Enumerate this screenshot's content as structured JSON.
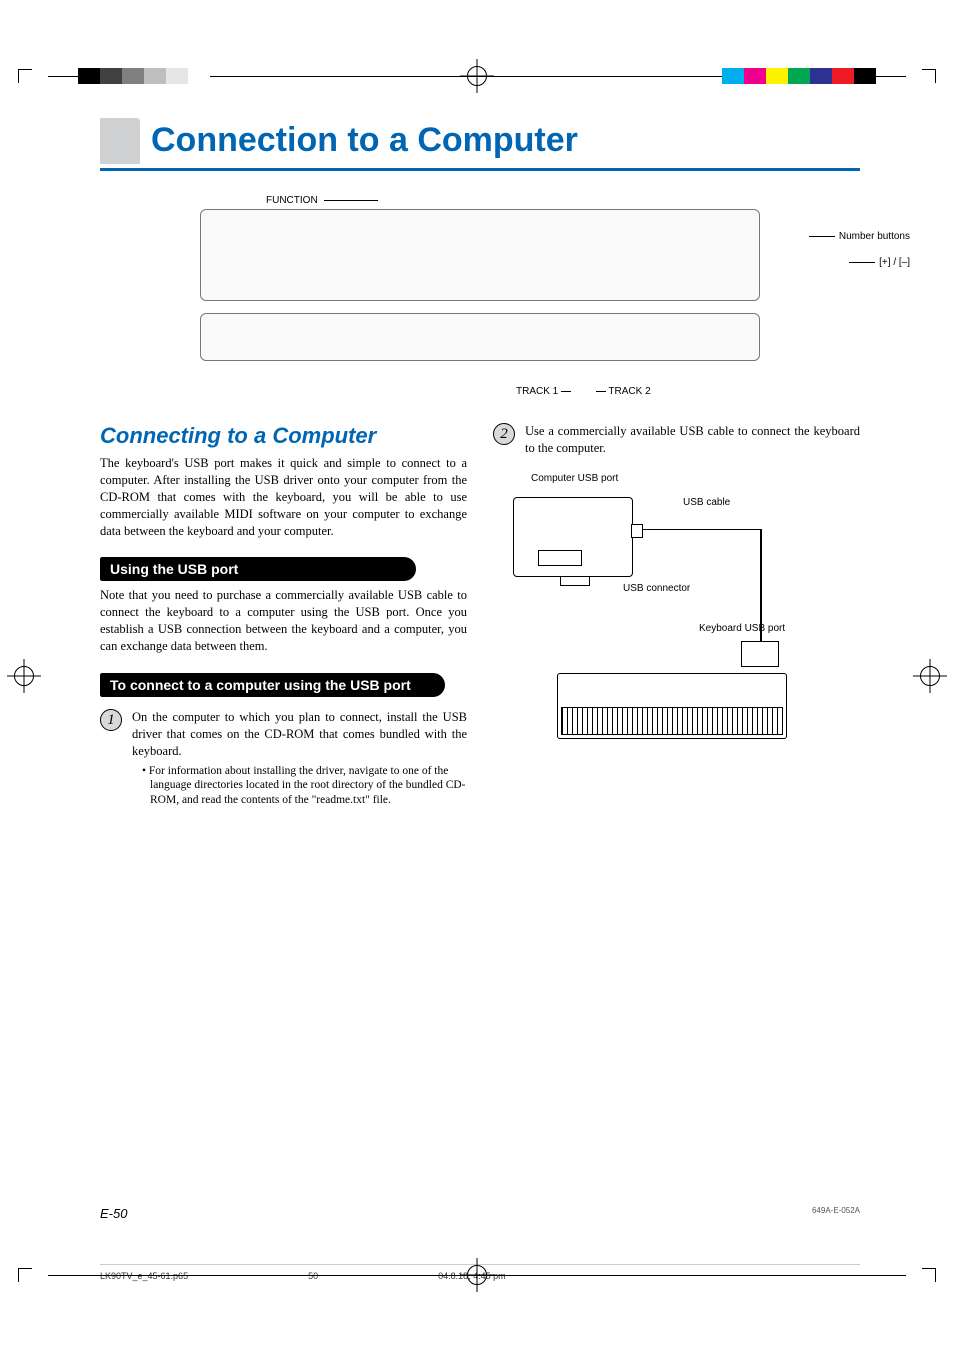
{
  "title": "Connection to a Computer",
  "callouts": {
    "function": "FUNCTION",
    "number_buttons": "Number buttons",
    "plus_minus": "[+] / [–]",
    "track1": "TRACK 1",
    "track2": "TRACK 2"
  },
  "left_column": {
    "section_title": "Connecting to a Computer",
    "intro_para": "The keyboard's USB port makes it quick and simple to connect to a computer. After installing the USB driver onto your computer from the CD-ROM that comes with the keyboard, you will be able to use commercially available MIDI software on your computer to exchange data between the keyboard and your computer.",
    "sub1_title": "Using the USB port",
    "sub1_para": "Note that you need to purchase a commercially available USB cable to connect the keyboard to a computer using the USB port. Once you establish a USB connection between the keyboard and a computer, you can exchange data between them.",
    "sub2_title": "To connect to a computer using the USB port",
    "step1_num": "1",
    "step1_text": "On the computer to which you plan to connect, install the USB driver that comes on the CD-ROM that comes bundled with the keyboard.",
    "step1_bullet": "For information about installing the driver, navigate to one of the language directories located in the root directory of the bundled CD-ROM, and read the contents of the \"readme.txt\" file."
  },
  "right_column": {
    "step2_num": "2",
    "step2_text": "Use a commercially available USB cable to connect the keyboard to the computer.",
    "labels": {
      "computer_port": "Computer USB port",
      "usb_cable": "USB cable",
      "usb_connector": "USB connector",
      "keyboard_port": "Keyboard USB port"
    }
  },
  "footer": {
    "page_num": "E-50",
    "doc_code": "649A-E-052A",
    "imposition_file": "LK90TV_e_45-61.p65",
    "imposition_page": "50",
    "imposition_date": "04.8.18, 4:45 pm"
  }
}
